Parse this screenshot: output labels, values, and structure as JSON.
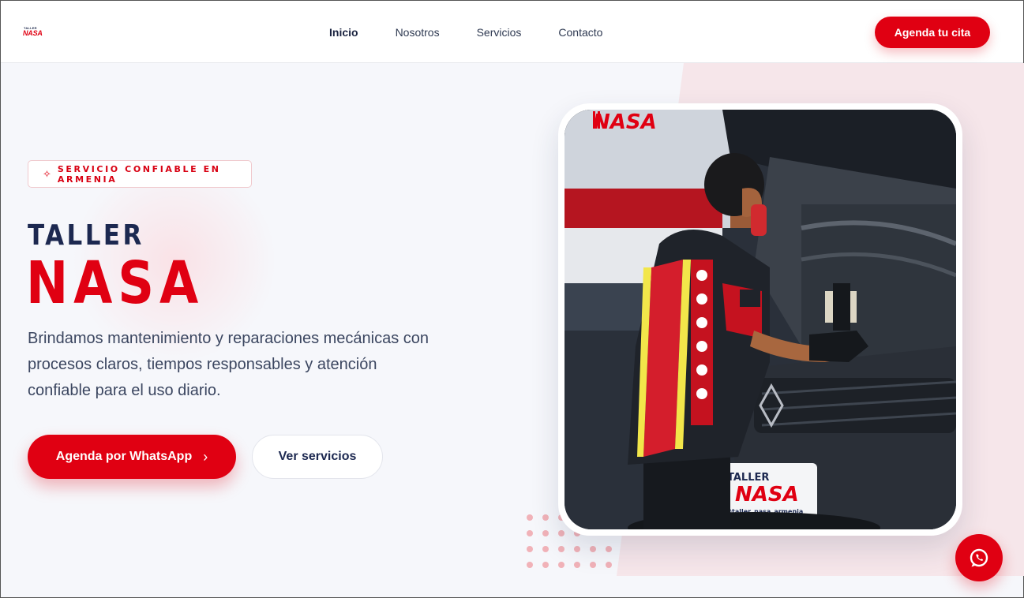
{
  "header": {
    "logo_small": "TALLER",
    "logo_big": "NASA",
    "nav": [
      "Inicio",
      "Nosotros",
      "Servicios",
      "Contacto"
    ],
    "cta": "Agenda tu cita"
  },
  "hero": {
    "badge": "SERVICIO CONFIABLE EN ARMENIA",
    "title_top": "TALLER",
    "title_main": "NASA",
    "description": "Brindamos mantenimiento y reparaciones mecánicas con procesos claros, tiempos responsables y atención confiable para el uso diario.",
    "btn_whatsapp": "Agenda por WhatsApp",
    "btn_services": "Ver servicios"
  },
  "photo": {
    "wall_brand": "NASA",
    "plate_top": "TALLER",
    "plate_main": "NASA",
    "plate_handle": "@taller_nasa_armenia"
  },
  "colors": {
    "brand_red": "#e00012",
    "navy": "#1c2850",
    "bg": "#f6f7fb"
  },
  "icons": [
    "sparkle-icon",
    "chevron-right-icon",
    "whatsapp-icon"
  ]
}
